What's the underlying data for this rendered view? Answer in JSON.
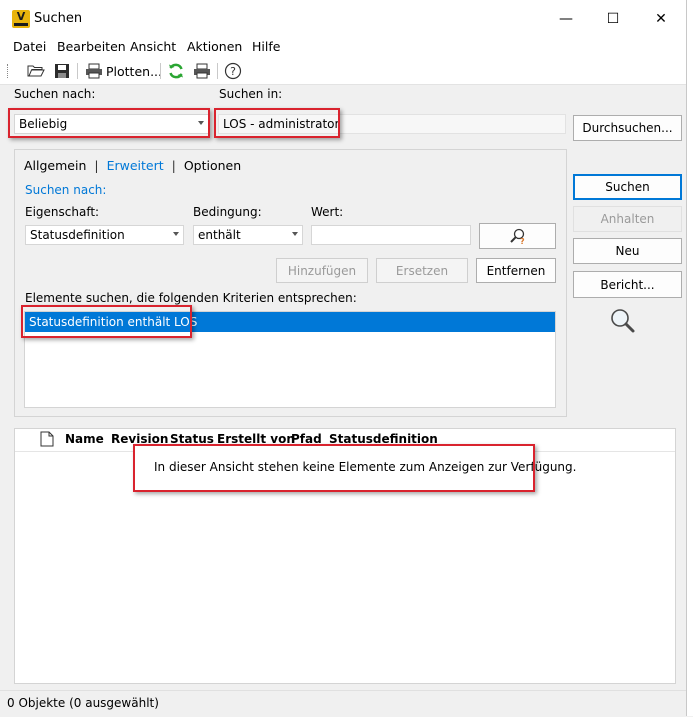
{
  "window": {
    "title": "Suchen",
    "app_icon_letter": "V",
    "controls": {
      "minimize": "—",
      "maximize": "☐",
      "close": "✕"
    }
  },
  "menu": [
    "Datei",
    "Bearbeiten",
    "Ansicht",
    "Aktionen",
    "Hilfe"
  ],
  "toolbar": {
    "plot_label": "Plotten...",
    "icons": [
      "open-folder-icon",
      "save-icon",
      "print-icon",
      "refresh-icon",
      "print-icon",
      "help-icon"
    ]
  },
  "search": {
    "search_for_label": "Suchen nach:",
    "search_for_value": "Beliebig",
    "search_in_label": "Suchen in:",
    "search_in_value": "LOS - administrator",
    "browse_button": "Durchsuchen..."
  },
  "tabs": {
    "general": "Allgemein",
    "sep": "|",
    "advanced": "Erweitert",
    "options": "Optionen"
  },
  "advanced": {
    "section_title": "Suchen nach:",
    "property_label": "Eigenschaft:",
    "property_value": "Statusdefinition",
    "condition_label": "Bedingung:",
    "condition_value": "enthält",
    "value_label": "Wert:",
    "value_value": "",
    "add_button": "Hinzufügen",
    "replace_button": "Ersetzen",
    "remove_button": "Entfernen",
    "criteria_label": "Elemente suchen, die folgenden Kriterien entsprechen:",
    "criteria": [
      "Statusdefinition enthält LOS"
    ]
  },
  "actions": {
    "search": "Suchen",
    "stop": "Anhalten",
    "new": "Neu",
    "report": "Bericht..."
  },
  "results": {
    "columns": [
      "Name",
      "Revision",
      "Status",
      "Erstellt von",
      "Pfad",
      "Statusdefinition"
    ],
    "empty_message": "In dieser Ansicht stehen keine Elemente zum Anzeigen zur Verfügung."
  },
  "statusbar": {
    "text": "0 Objekte (0 ausgewählt)"
  },
  "colors": {
    "accent": "#0078d7",
    "highlight_box": "#d9232e",
    "app_icon": "#e8b40d",
    "refresh_icon": "#2aa532"
  }
}
